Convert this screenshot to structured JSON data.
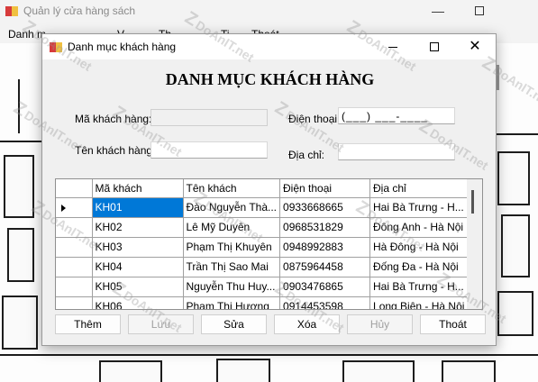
{
  "main_window": {
    "title": "Quản lý cửa hàng sách",
    "menu": [
      "Danh m",
      "V",
      "Th",
      "Ti",
      "Thoát"
    ],
    "minimize_glyph": "—"
  },
  "dialog": {
    "title": "Danh mục khách hàng",
    "close_glyph": "✕",
    "heading": "DANH MỤC KHÁCH HÀNG"
  },
  "form": {
    "ma_label": "Mã khách hàng:",
    "ma_value": "",
    "ten_label": "Tên khách hàng",
    "ten_value": "",
    "phone_label": "Điện thoại:",
    "phone_value": "(___) ___-____",
    "address_label": "Địa chỉ:",
    "address_value": ""
  },
  "grid": {
    "columns": [
      "Mã khách",
      "Tên khách",
      "Điện thoại",
      "Địa chỉ"
    ],
    "rows": [
      {
        "ma": "KH01",
        "ten": "Đào Nguyễn Thà...",
        "phone": "0933668665",
        "address": "Hai Bà Trưng - H..."
      },
      {
        "ma": "KH02",
        "ten": "Lê Mỹ Duyên",
        "phone": "0968531829",
        "address": "Đông Anh - Hà Nội"
      },
      {
        "ma": "KH03",
        "ten": "Phạm Thị Khuyên",
        "phone": "0948992883",
        "address": "Hà Đông - Hà Nội"
      },
      {
        "ma": "KH04",
        "ten": "Trần Thị Sao Mai",
        "phone": "0875964458",
        "address": "Đống Đa - Hà Nội"
      },
      {
        "ma": "KH05",
        "ten": "Nguyễn Thu Huy...",
        "phone": "0903476865",
        "address": "Hai Bà Trưng - H..."
      },
      {
        "ma": "KH06",
        "ten": "Phạm Thị Hương",
        "phone": "0914453598",
        "address": "Long Biên - Hà Nội"
      }
    ],
    "selected_row": 0
  },
  "buttons": {
    "them": "Thêm",
    "luu": "Lưu",
    "sua": "Sửa",
    "xoa": "Xóa",
    "huy": "Hủy",
    "thoat": "Thoát"
  },
  "watermark": {
    "text": "DoAnIT.net"
  },
  "colors": {
    "selection": "#0078d7",
    "dialog_bg": "#f0f0f0",
    "grid_bg": "#ababab"
  }
}
